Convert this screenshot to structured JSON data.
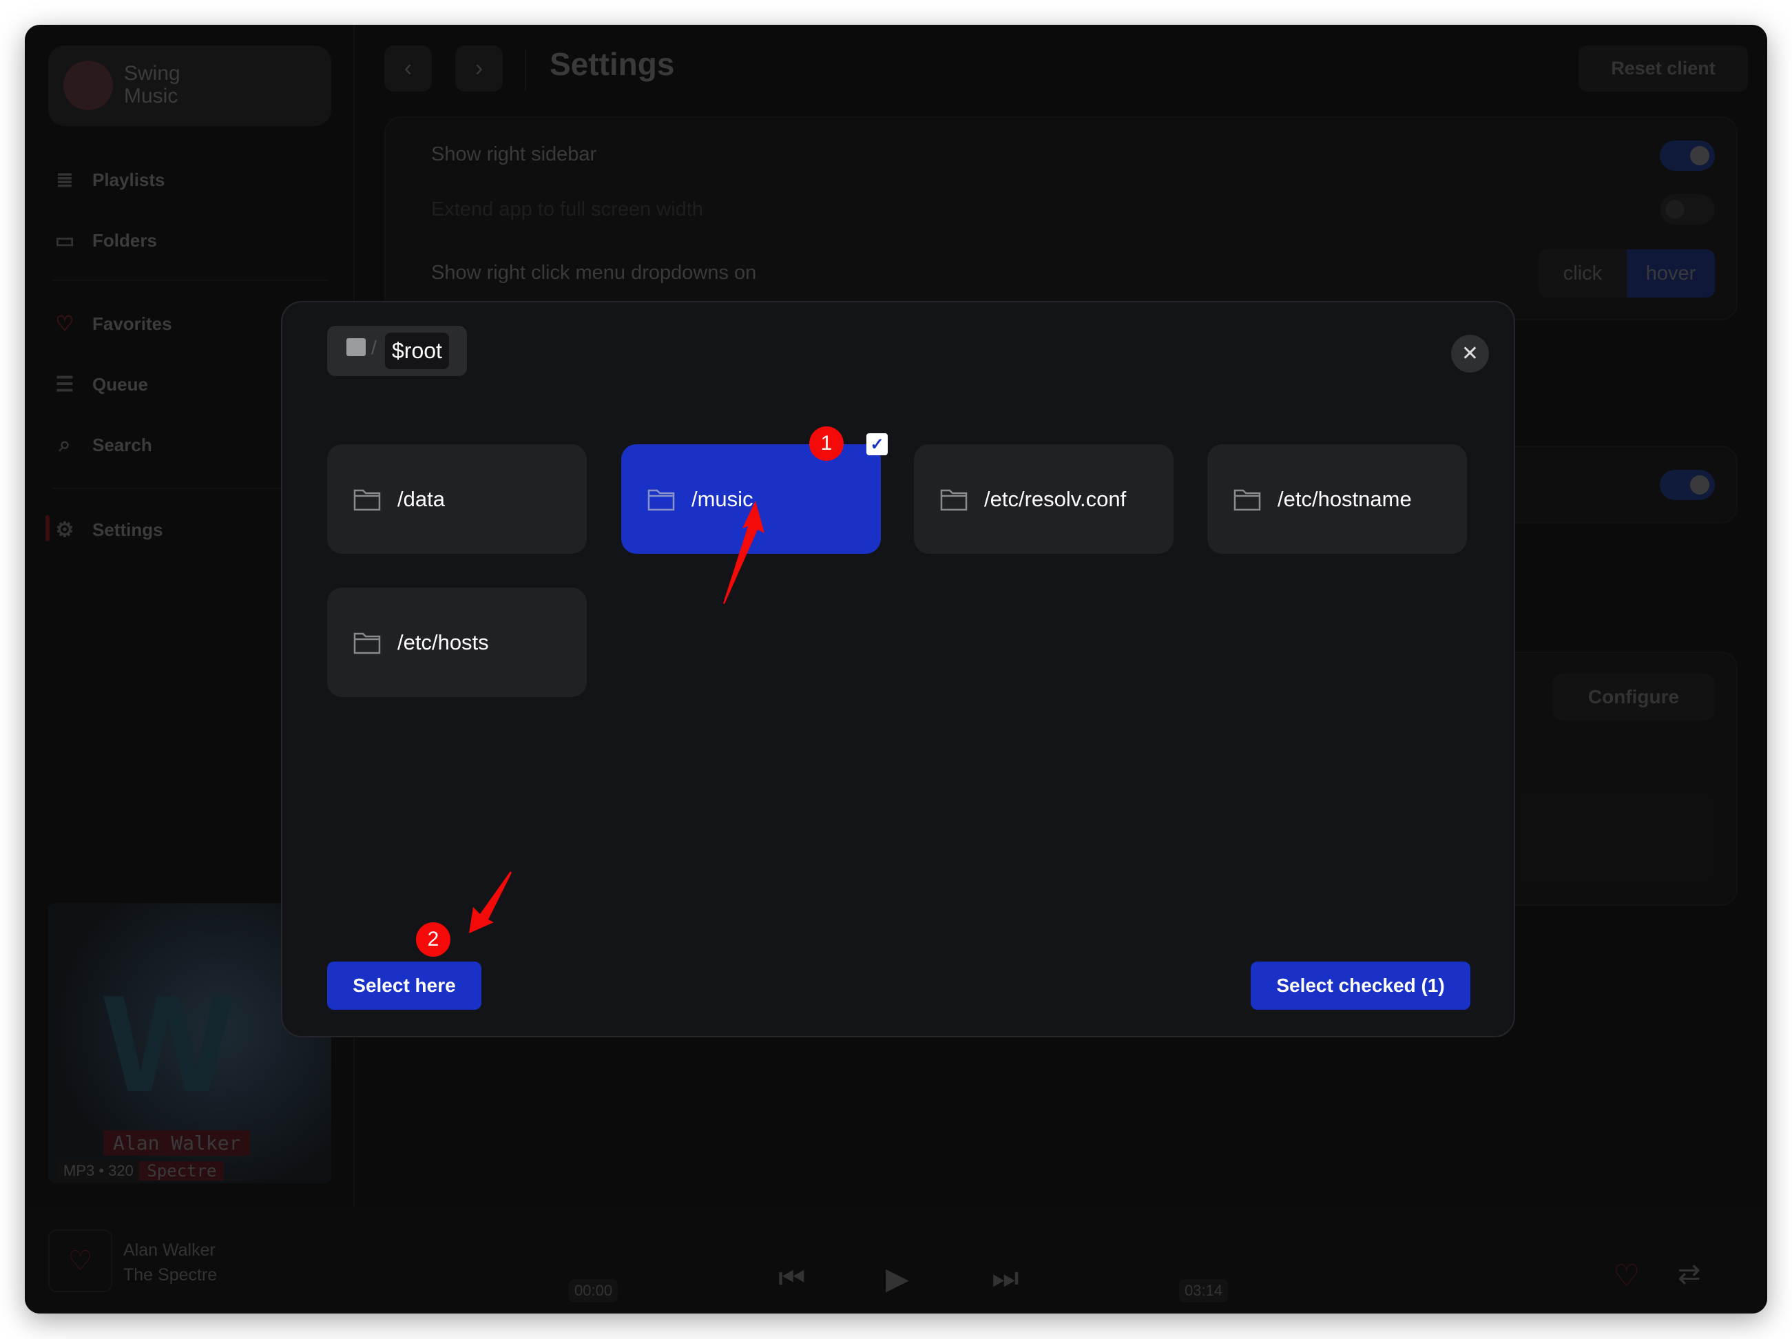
{
  "app": {
    "name_line1": "Swing",
    "name_line2": "Music"
  },
  "sidebar": {
    "items": [
      {
        "label": "Playlists",
        "icon": "playlist-icon"
      },
      {
        "label": "Folders",
        "icon": "folder-music-icon"
      },
      {
        "label": "Favorites",
        "icon": "heart-icon"
      },
      {
        "label": "Queue",
        "icon": "queue-icon"
      },
      {
        "label": "Search",
        "icon": "search-icon"
      },
      {
        "label": "Settings",
        "icon": "gear-icon"
      }
    ]
  },
  "header": {
    "title": "Settings",
    "reset_label": "Reset client"
  },
  "settings": {
    "show_right_sidebar": "Show right sidebar",
    "extend_full_width": "Extend app to full screen width",
    "right_click_dropdowns": "Show right click menu dropdowns on",
    "option_click": "click",
    "option_hover": "hover",
    "configure_label": "Configure",
    "toggles": {
      "show_right_sidebar": true,
      "extend_full_width": false,
      "second_card": true
    }
  },
  "now_playing": {
    "art_artist": "Alan Walker",
    "art_title": "he Spectre",
    "format": "MP3 • 320",
    "artist": "Alan Walker",
    "title": "The Spectre",
    "elapsed": "00:00",
    "duration": "03:14",
    "progress": 0
  },
  "modal": {
    "breadcrumb": "$root",
    "folders": [
      {
        "path": "/data",
        "checked": false
      },
      {
        "path": "/music",
        "checked": true
      },
      {
        "path": "/etc/resolv.conf",
        "checked": false
      },
      {
        "path": "/etc/hostname",
        "checked": false
      },
      {
        "path": "/etc/hosts",
        "checked": false
      }
    ],
    "select_here": "Select here",
    "select_checked": "Select checked (1)"
  },
  "annotations": {
    "badge1": "1",
    "badge2": "2",
    "color": "#f50a0a"
  },
  "colors": {
    "accent": "#1a31c7",
    "modal_bg": "#131417",
    "card_bg": "#202124"
  }
}
